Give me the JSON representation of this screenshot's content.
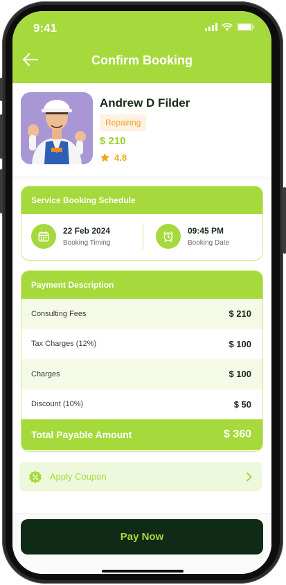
{
  "status_bar": {
    "time": "9:41"
  },
  "header": {
    "title": "Confirm Booking"
  },
  "provider": {
    "name": "Andrew D Filder",
    "tag": "Repairing",
    "price": "$ 210",
    "rating": "4.8"
  },
  "schedule": {
    "title": "Service Booking Schedule",
    "date_value": "22 Feb 2024",
    "date_label": "Booking Timing",
    "time_value": "09:45 PM",
    "time_label": "Booking Date"
  },
  "payment": {
    "title": "Payment Description",
    "rows": [
      {
        "label": "Consulting Fees",
        "amount": "$ 210"
      },
      {
        "label": "Tax Charges (12%)",
        "amount": "$ 100"
      },
      {
        "label": "Charges",
        "amount": "$ 100"
      },
      {
        "label": "Discount (10%)",
        "amount": "$ 50"
      }
    ],
    "total_label": "Total Payable Amount",
    "total_amount": "$ 360"
  },
  "coupon": {
    "label": "Apply Coupon"
  },
  "footer": {
    "pay_label": "Pay Now"
  },
  "colors": {
    "accent": "#a6d93b",
    "dark": "#0f2a17",
    "tag_bg": "#fff2e0",
    "tag_text": "#f0a030",
    "star": "#f2a516"
  },
  "icons": [
    "back-arrow-icon",
    "signal-icon",
    "wifi-icon",
    "battery-icon",
    "star-icon",
    "calendar-icon",
    "alarm-clock-icon",
    "discount-badge-icon",
    "chevron-right-icon"
  ]
}
